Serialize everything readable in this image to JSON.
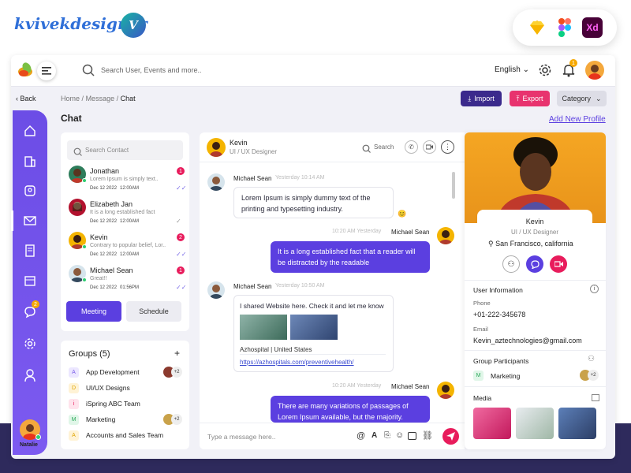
{
  "brand": {
    "name": "kvivekdesigner",
    "logo_letter": "V"
  },
  "tools": [
    {
      "name": "sketch-icon",
      "color": "#f7b500"
    },
    {
      "name": "figma-icon",
      "color": "#f24e1e"
    },
    {
      "name": "xd-icon",
      "label": "Xd",
      "color": "#470137"
    }
  ],
  "topbar": {
    "search_placeholder": "Search User, Events and more..",
    "language": "English",
    "notif_count": "1"
  },
  "subheader": {
    "back_label": "Back",
    "breadcrumb": [
      "Home",
      "/",
      "Message",
      "/",
      "Chat"
    ],
    "import_label": "Import",
    "export_label": "Export",
    "category_label": "Category",
    "page_title": "Chat",
    "add_profile_label": "Add New Profile"
  },
  "sidebar": {
    "chat_badge": "2",
    "user_name": "Natalie"
  },
  "contacts": {
    "search_placeholder": "Search Contact",
    "items": [
      {
        "name": "Jonathan",
        "preview": "Lorem Ipsum is simply text..",
        "date": "Dec 12 2022",
        "time": "12:00AM",
        "badge": "1"
      },
      {
        "name": "Elizabeth Jan",
        "preview": "It is a long established fact",
        "date": "Dec 12 2022",
        "time": "12:00AM",
        "badge": ""
      },
      {
        "name": "Kevin",
        "preview": "Contrary to popular belief, Lor..",
        "date": "Dec 12 2022",
        "time": "12:00AM",
        "badge": "2"
      },
      {
        "name": "Michael Sean",
        "preview": "Great!!",
        "date": "Dec 12 2022",
        "time": "01:56PM",
        "badge": "1"
      }
    ],
    "meeting_label": "Meeting",
    "schedule_label": "Schedule"
  },
  "groups": {
    "title": "Groups (5)",
    "add": "+",
    "items": [
      {
        "letter": "A",
        "name": "App Development",
        "extra": "+2",
        "color": "#7b5ce8",
        "bg": "#ece7ff"
      },
      {
        "letter": "D",
        "name": "UI/UX Designs",
        "extra": "",
        "color": "#e0a400",
        "bg": "#fff3d6"
      },
      {
        "letter": "i",
        "name": "iSpring ABC Team",
        "extra": "",
        "color": "#e81c5c",
        "bg": "#ffe3ec"
      },
      {
        "letter": "M",
        "name": "Marketing",
        "extra": "+2",
        "color": "#2eaa5c",
        "bg": "#e0f6e8"
      },
      {
        "letter": "A",
        "name": "Accounts and Sales Team",
        "extra": "",
        "color": "#e0a400",
        "bg": "#fff3d6"
      }
    ]
  },
  "chat": {
    "contact_name": "Kevin",
    "contact_role": "UI / UX Designer",
    "search_label": "Search",
    "messages": [
      {
        "sender": "Michael Sean",
        "time": "Yesterday 10:14 AM",
        "text": "Lorem Ipsum is simply dummy text of the printing and typesetting industry."
      },
      {
        "sender": "Michael Sean",
        "time": "10:20 AM Yesterday",
        "text": "It is a long established fact that a reader will be distracted by the readable"
      },
      {
        "sender": "Michael Sean",
        "time": "Yesterday 10:50 AM",
        "text": "I shared Website here. Check it and let me know",
        "link_title": "Azhospital | United States",
        "link_url": "https://azhospitals.com/preventivehealth/"
      },
      {
        "sender": "Michael Sean",
        "time": "10:20 AM Yesterday",
        "text": "There are many variations of passages of Lorem Ipsum available, but the majority."
      }
    ],
    "input_placeholder": "Type a message here.."
  },
  "profile": {
    "name": "Kevin",
    "role": "UI / UX Designer",
    "location": "San Francisco, california",
    "user_info_label": "User Information",
    "phone_label": "Phone",
    "phone": "+01-222-345678",
    "email_label": "Email",
    "email": "Kevin_aztechnologies@gmail.com",
    "participants_label": "Group Participants",
    "participant_group": "Marketing",
    "participant_extra": "+2",
    "media_label": "Media"
  },
  "colors": {
    "primary": "#5b3fe0",
    "accent": "#e81c5c",
    "sidebar": "#6c4de6",
    "import": "#3b2a8c",
    "export": "#e8336e"
  }
}
